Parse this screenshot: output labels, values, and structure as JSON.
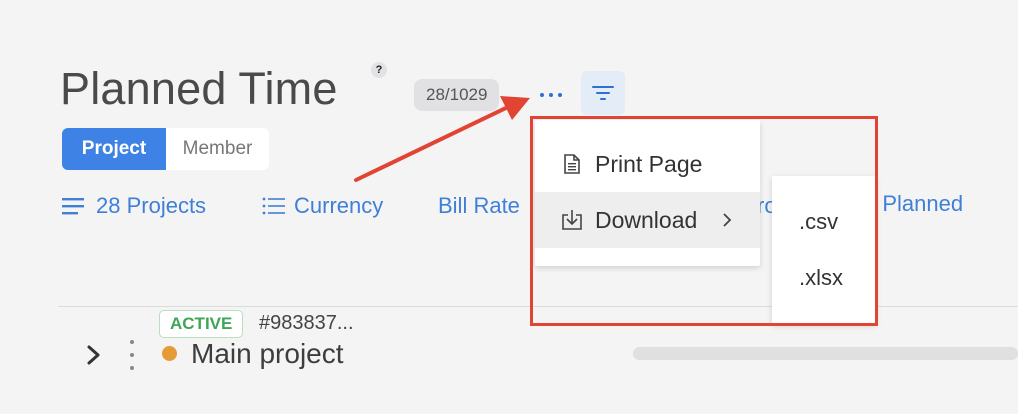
{
  "header": {
    "title": "Planned Time",
    "help_badge": "?",
    "count": "28/1029",
    "more_icon": "more-horizontal-icon",
    "filter_icon": "filter-lines-icon"
  },
  "view_toggle": {
    "options": [
      "Project",
      "Member"
    ],
    "selected": "Project",
    "selected_color": "#3f82e6"
  },
  "filters": {
    "projects": "28 Projects",
    "currency": "Currency",
    "bill_rate": "Bill Rate",
    "partial_hidden": "ro",
    "planned_partial": "o Planned"
  },
  "menu": {
    "items": [
      {
        "label": "Print Page",
        "icon": "document-icon"
      },
      {
        "label": "Download",
        "icon": "download-icon",
        "has_submenu": true
      }
    ],
    "submenu": [
      ".csv",
      ".xlsx"
    ]
  },
  "row": {
    "status": "ACTIVE",
    "project_id": "#983837...",
    "name": "Main project",
    "status_color": "#e79b34"
  },
  "annotation_color": "#e24434"
}
